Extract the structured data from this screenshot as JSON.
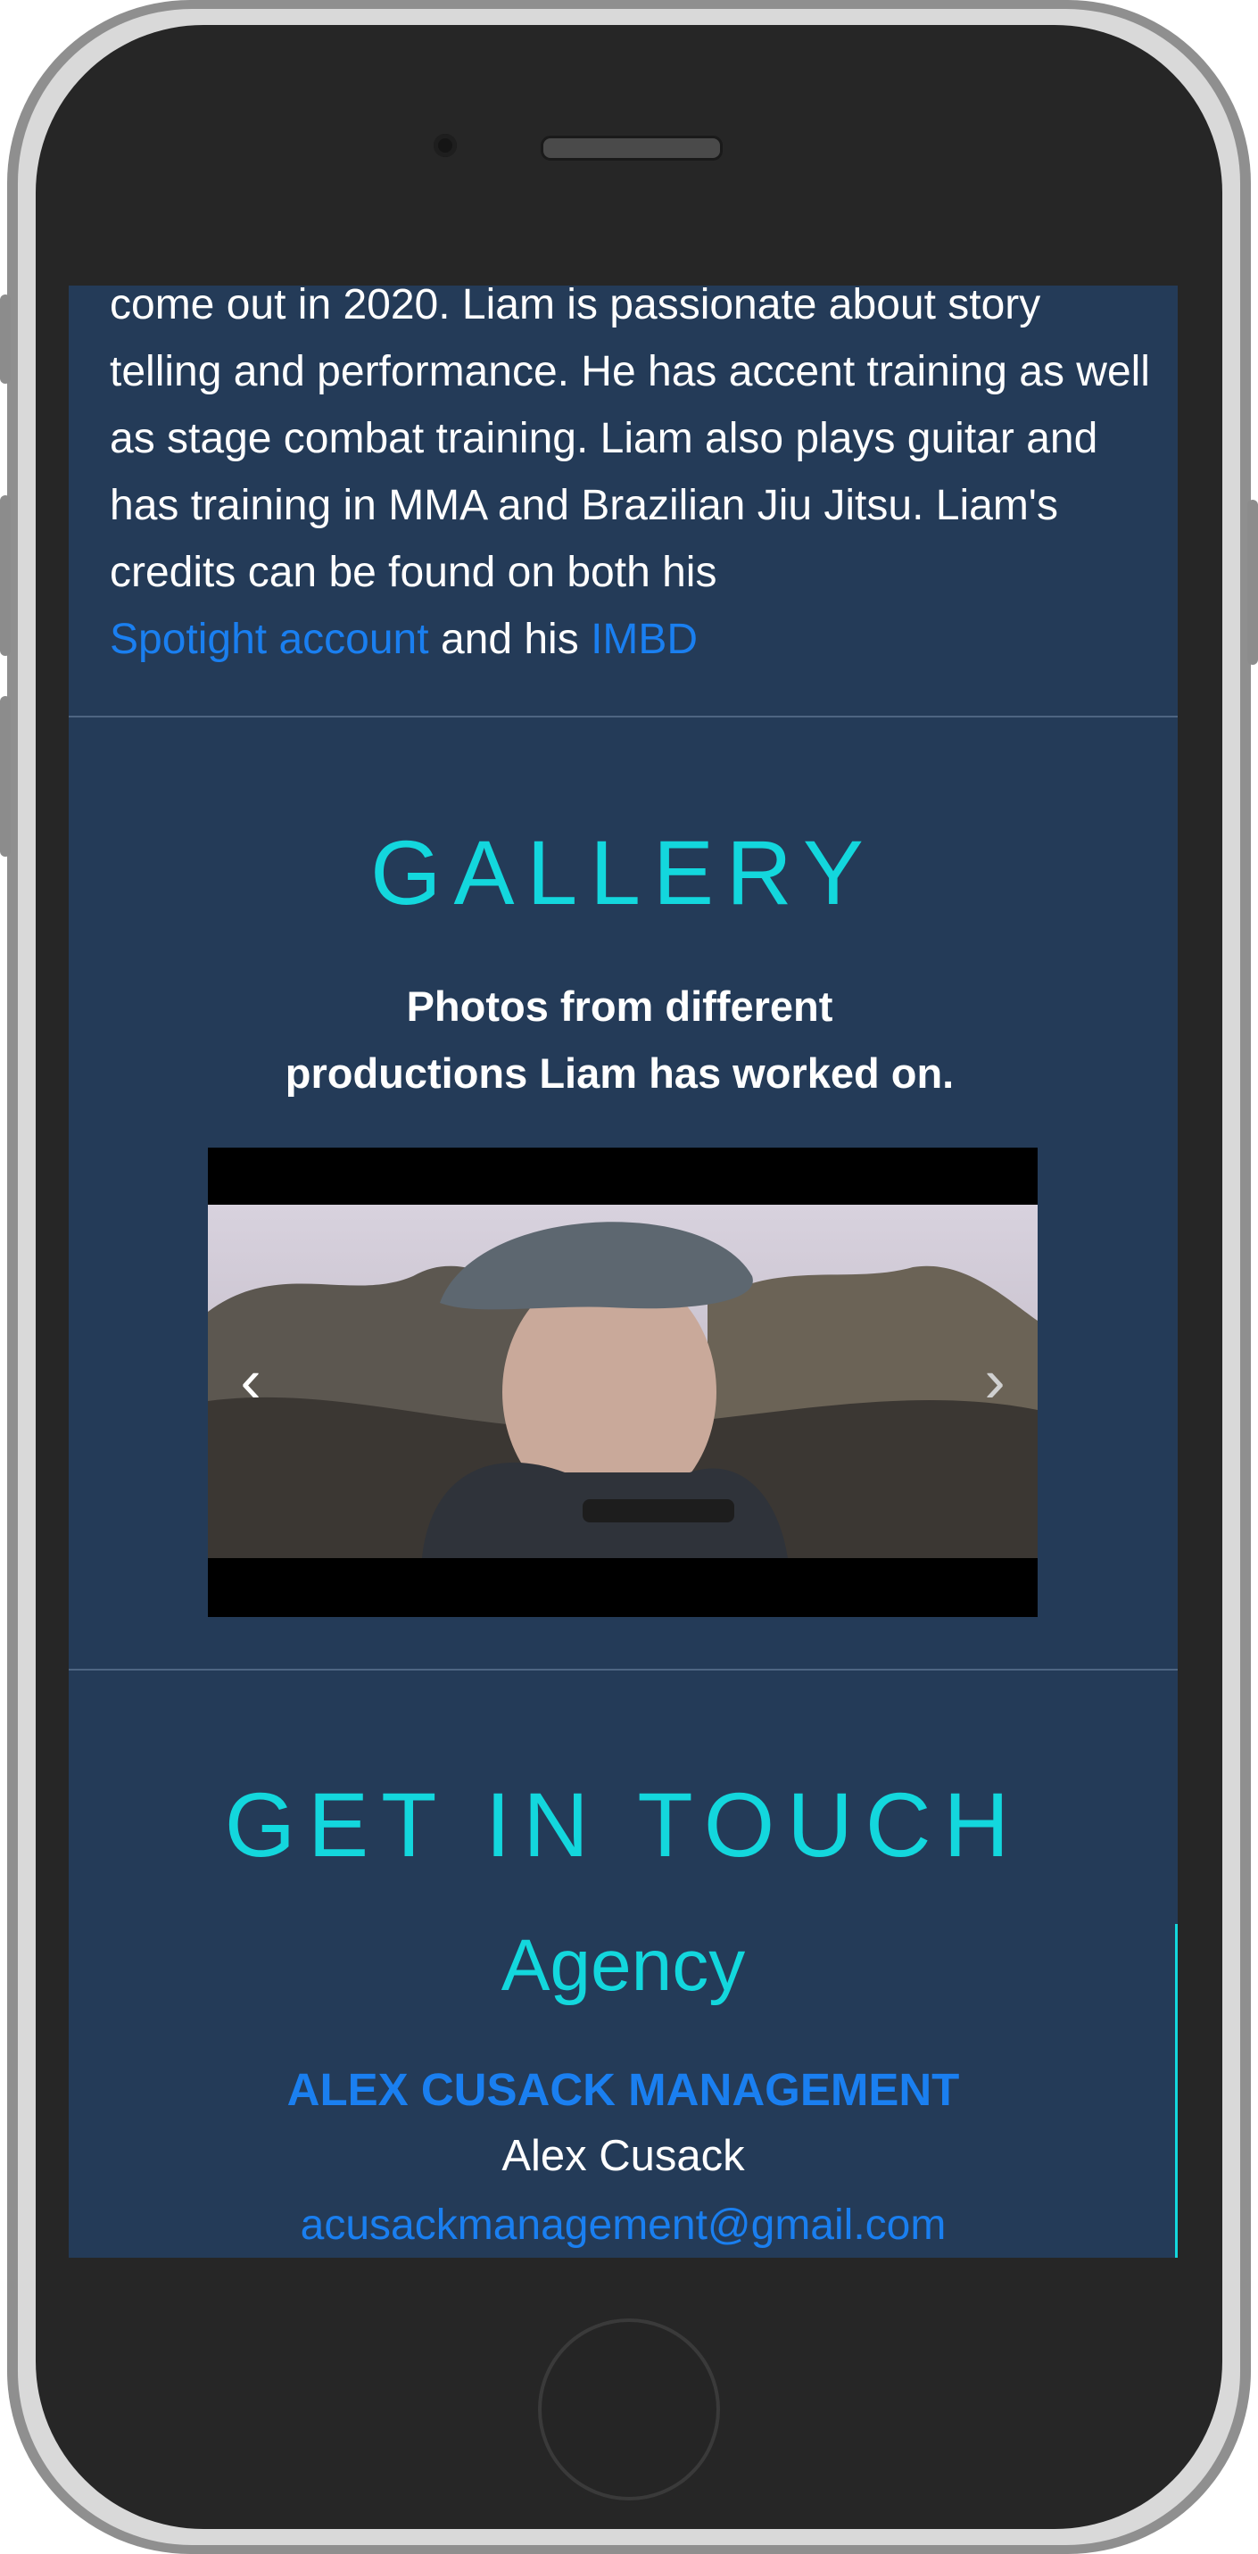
{
  "bio": {
    "text_before_links": "come out in 2020. Liam is passionate about story telling and performance. He has accent training as well as stage combat training. Liam also plays guitar and has training in MMA and Brazilian Jiu Jitsu. Liam's credits can be found on both his",
    "link_spotlight": "Spotight account",
    "text_between": "and his",
    "link_imdb": "IMBD"
  },
  "gallery": {
    "title": "GALLERY",
    "subtitle_line1": "Photos from different",
    "subtitle_line2": "productions Liam has worked on.",
    "prev_icon": "chevron-left-icon",
    "next_icon": "chevron-right-icon"
  },
  "contact": {
    "title": "GET IN TOUCH",
    "agency_heading": "Agency",
    "agency_name": "ALEX CUSACK MANAGEMENT",
    "agent_name": "Alex Cusack",
    "agent_email": "acusackmanagement@gmail.com"
  },
  "colors": {
    "background": "#243b58",
    "accent": "#13d7dd",
    "link": "#1a7ff0"
  }
}
